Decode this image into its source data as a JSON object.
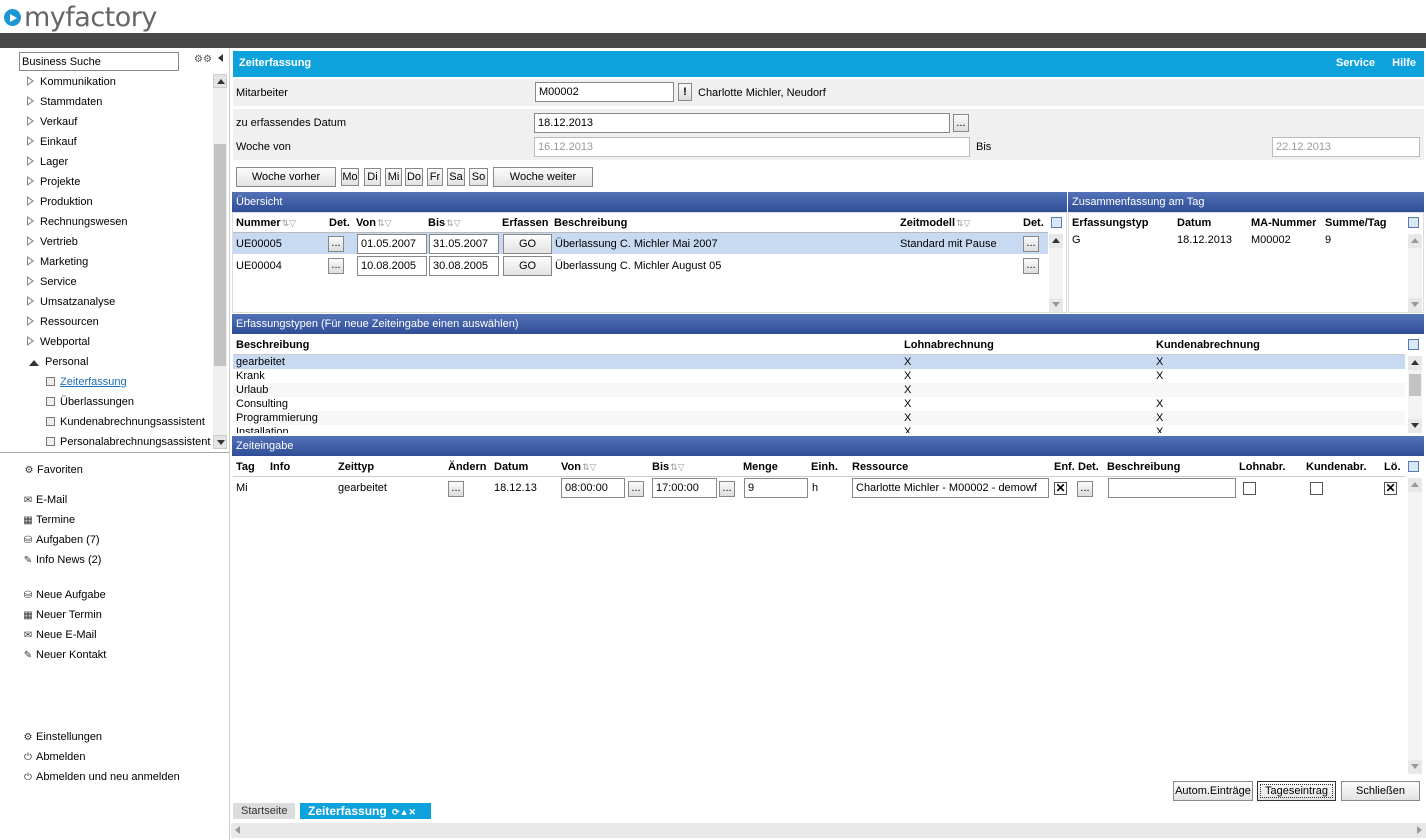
{
  "app": {
    "logo_text": "myfactory",
    "accent": "#0ea2dd",
    "section_color": "#3a58a3"
  },
  "sidebar": {
    "search_value": "Business Suche",
    "tree": [
      {
        "label": "Kommunikation"
      },
      {
        "label": "Stammdaten"
      },
      {
        "label": "Verkauf"
      },
      {
        "label": "Einkauf"
      },
      {
        "label": "Lager"
      },
      {
        "label": "Projekte"
      },
      {
        "label": "Produktion"
      },
      {
        "label": "Rechnungswesen"
      },
      {
        "label": "Vertrieb"
      },
      {
        "label": "Marketing"
      },
      {
        "label": "Service"
      },
      {
        "label": "Umsatzanalyse"
      },
      {
        "label": "Ressourcen"
      },
      {
        "label": "Webportal"
      },
      {
        "label": "Personal"
      }
    ],
    "personal_children": [
      {
        "label": "Zeiterfassung",
        "selected": true
      },
      {
        "label": "Überlassungen"
      },
      {
        "label": "Kundenabrechnungsassistent"
      },
      {
        "label": "Personalabrechnungsassistent"
      }
    ],
    "links": {
      "favoriten": "Favoriten",
      "email": "E-Mail",
      "termine": "Termine",
      "aufgaben": "Aufgaben (7)",
      "infonews": "Info News (2)",
      "neue_aufgabe": "Neue Aufgabe",
      "neuer_termin": "Neuer Termin",
      "neue_email": "Neue E-Mail",
      "neuer_kontakt": "Neuer Kontakt",
      "einstellungen": "Einstellungen",
      "abmelden": "Abmelden",
      "abmelden_neu": "Abmelden und neu anmelden"
    }
  },
  "header": {
    "title": "Zeiterfassung",
    "service": "Service",
    "hilfe": "Hilfe"
  },
  "form": {
    "mitarbeiter_label": "Mitarbeiter",
    "mitarbeiter_value": "M00002",
    "mitarbeiter_warn": "!",
    "mitarbeiter_name": "Charlotte Michler, Neudorf",
    "datum_label": "zu erfassendes Datum",
    "datum_value": "18.12.2013",
    "woche_von_label": "Woche von",
    "woche_von_value": "16.12.2013",
    "bis_label": "Bis",
    "bis_value": "22.12.2013",
    "woche_vorher": "Woche vorher",
    "woche_weiter": "Woche weiter",
    "days": [
      "Mo",
      "Di",
      "Mi",
      "Do",
      "Fr",
      "Sa",
      "So"
    ],
    "ellipsis": "..."
  },
  "uebersicht": {
    "title": "Übersicht",
    "headers": {
      "nummer": "Nummer",
      "det": "Det.",
      "von": "Von",
      "bis": "Bis",
      "erfassen": "Erfassen",
      "beschreibung": "Beschreibung",
      "zeitmodell": "Zeitmodell",
      "det2": "Det."
    },
    "rows": [
      {
        "nummer": "UE00005",
        "von": "01.05.2007",
        "bis": "31.05.2007",
        "go": "GO",
        "beschreibung": "Überlassung C. Michler Mai 2007",
        "zeitmodell": "Standard mit Pause",
        "selected": true
      },
      {
        "nummer": "UE00004",
        "von": "10.08.2005",
        "bis": "30.08.2005",
        "go": "GO",
        "beschreibung": "Überlassung C. Michler August 05",
        "zeitmodell": "",
        "selected": false
      }
    ]
  },
  "zusammenfassung": {
    "title": "Zusammenfassung am Tag",
    "headers": {
      "typ": "Erfassungstyp",
      "datum": "Datum",
      "ma": "MA-Nummer",
      "summe": "Summe/Tag"
    },
    "rows": [
      {
        "typ": "G",
        "datum": "18.12.2013",
        "ma": "M00002",
        "summe": "9"
      }
    ]
  },
  "erfassungstypen": {
    "title": "Erfassungstypen (Für neue Zeiteingabe einen auswählen)",
    "headers": {
      "beschreibung": "Beschreibung",
      "lohn": "Lohnabrechnung",
      "kunde": "Kundenabrechnung"
    },
    "rows": [
      {
        "beschreibung": "gearbeitet",
        "lohn": "X",
        "kunde": "X",
        "selected": true
      },
      {
        "beschreibung": "Krank",
        "lohn": "X",
        "kunde": "X"
      },
      {
        "beschreibung": "Urlaub",
        "lohn": "X",
        "kunde": ""
      },
      {
        "beschreibung": "Consulting",
        "lohn": "X",
        "kunde": "X"
      },
      {
        "beschreibung": "Programmierung",
        "lohn": "X",
        "kunde": "X"
      },
      {
        "beschreibung": "Installation",
        "lohn": "X",
        "kunde": "X"
      }
    ]
  },
  "zeiteingabe": {
    "title": "Zeiteingabe",
    "headers": {
      "tag": "Tag",
      "info": "Info",
      "zeittyp": "Zeittyp",
      "aendern": "Ändern",
      "datum": "Datum",
      "von": "Von",
      "bis": "Bis",
      "menge": "Menge",
      "einh": "Einh.",
      "ressource": "Ressource",
      "enf": "Enf.",
      "det": "Det.",
      "beschreibung": "Beschreibung",
      "lohnabr": "Lohnabr.",
      "kundenabr": "Kundenabr.",
      "loe": "Lö."
    },
    "row": {
      "tag": "Mi",
      "info": "",
      "zeittyp": "gearbeitet",
      "datum": "18.12.13",
      "von": "08:00:00",
      "bis": "17:00:00",
      "menge": "9",
      "einh": "h",
      "ressource": "Charlotte Michler - M00002 - demowf",
      "enf_checked": true,
      "beschreibung": "",
      "lohnabr": false,
      "kundenabr": false,
      "loe": true
    }
  },
  "footer_buttons": {
    "autom": "Autom.Einträge",
    "tageseintrag": "Tageseintrag",
    "schliessen": "Schließen"
  },
  "bottom_tabs": {
    "startseite": "Startseite",
    "zeiterfassung": "Zeiterfassung"
  }
}
